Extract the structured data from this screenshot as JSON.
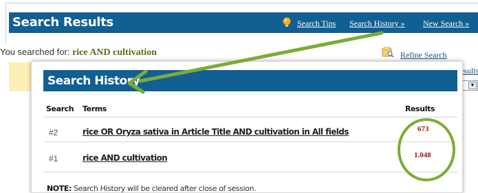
{
  "results_header": {
    "title": "Search Results",
    "search_tips": "Search Tips",
    "search_history": "Search History »",
    "new_search": "New Search »"
  },
  "searched_for": {
    "label": "You searched for:",
    "query": "rice AND cultivation"
  },
  "refine_search": "Refine Search",
  "results_partial_link": "Results",
  "popup": {
    "title": "Search History",
    "columns": {
      "search": "Search",
      "terms": "Terms",
      "results": "Results"
    },
    "rows": [
      {
        "num": "#2",
        "terms": "rice OR Oryza sativa in Article Title AND cultivation in All fields",
        "results": "673"
      },
      {
        "num": "#1",
        "terms": "rice AND cultivation",
        "results": "1.048"
      }
    ],
    "note_label": "NOTE:",
    "note_text": " Search History will be cleared after close of session."
  },
  "colors": {
    "header_blue": "#115f93",
    "annotation_green": "#7bac34",
    "result_red": "#a01414",
    "query_olive": "#5d6b14"
  },
  "icons": [
    "lightbulb-icon",
    "refine-search-icon",
    "chevron-down-icon"
  ]
}
